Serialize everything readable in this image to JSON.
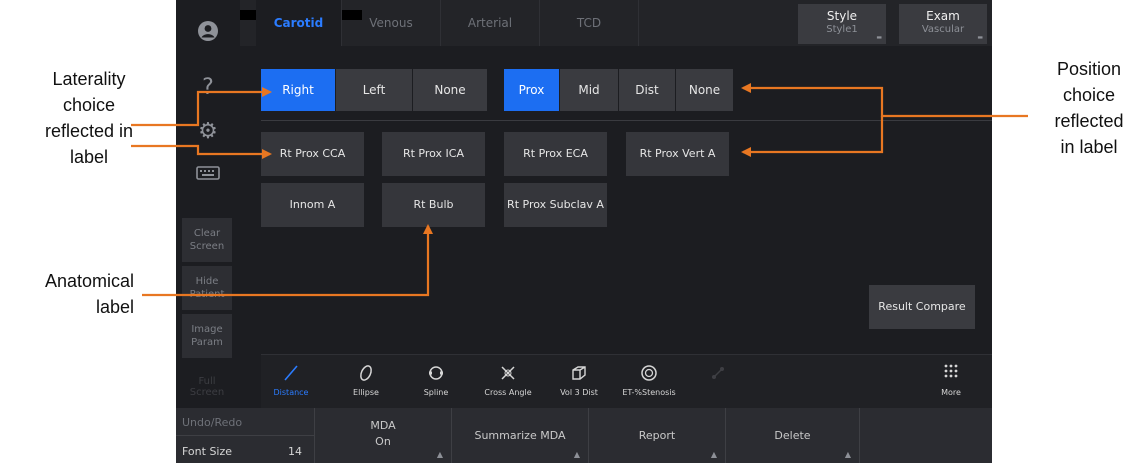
{
  "annotations": {
    "laterality": [
      "Laterality",
      "choice",
      "reflected in",
      "label"
    ],
    "position": [
      "Position",
      "choice",
      "reflected",
      "in label"
    ],
    "anatomical": [
      "Anatomical",
      "label"
    ]
  },
  "tabs": [
    {
      "label": "Carotid",
      "active": true
    },
    {
      "label": "Venous",
      "active": false
    },
    {
      "label": "Arterial",
      "active": false
    },
    {
      "label": "TCD",
      "active": false
    }
  ],
  "top_right": {
    "style": {
      "title": "Style",
      "value": "Style1"
    },
    "exam": {
      "title": "Exam",
      "value": "Vascular"
    }
  },
  "sidebar": {
    "help_glyph": "?",
    "buttons": [
      {
        "lines": [
          "Clear",
          "Screen"
        ]
      },
      {
        "lines": [
          "Hide",
          "Patient"
        ]
      },
      {
        "lines": [
          "Image",
          "Param"
        ]
      }
    ],
    "dimmed": "Full Screen"
  },
  "laterality": {
    "options": [
      "Right",
      "Left",
      "None"
    ],
    "selected": "Right"
  },
  "position": {
    "options": [
      "Prox",
      "Mid",
      "Dist",
      "None"
    ],
    "selected": "Prox"
  },
  "labels": [
    "Rt Prox CCA",
    "Rt Prox ICA",
    "Rt Prox ECA",
    "Rt Prox Vert A",
    "Innom A",
    "Rt  Bulb",
    "Rt Prox Subclav A"
  ],
  "result_compare": "Result Compare",
  "tools": [
    {
      "label": "Distance",
      "icon": "distance-icon",
      "active": true
    },
    {
      "label": "Ellipse",
      "icon": "ellipse-icon",
      "active": false
    },
    {
      "label": "Spline",
      "icon": "spline-icon",
      "active": false
    },
    {
      "label": "Cross Angle",
      "icon": "cross-angle-icon",
      "active": false
    },
    {
      "label": "Vol 3 Dist",
      "icon": "cube-icon",
      "active": false
    },
    {
      "label": "ET-%Stenosis",
      "icon": "stenosis-icon",
      "active": false
    },
    {
      "label": "",
      "icon": "trace-icon",
      "active": false,
      "disabled": true
    },
    {
      "label": "More",
      "icon": "grid-icon",
      "active": false
    }
  ],
  "bottom": {
    "undo_redo": "Undo/Redo",
    "font_size_label": "Font Size",
    "font_size_value": "14",
    "mda": "MDA",
    "mda_state": "On",
    "summarize": "Summarize MDA",
    "report": "Report",
    "delete": "Delete"
  },
  "colors": {
    "accent": "#1c6ef2",
    "arrow": "#e87722",
    "panel": "#1c1d21",
    "button": "#3a3b40"
  }
}
